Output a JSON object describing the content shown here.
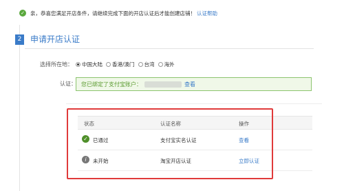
{
  "notice": {
    "icon": "check-circle-icon",
    "text": "亲，恭喜您满足开店条件，请继续完成下面的开店认证后才能创建店铺！",
    "link": "认证帮助"
  },
  "step": {
    "number": "2",
    "title": "申请开店认证"
  },
  "location": {
    "label": "选择所在地：",
    "options": [
      {
        "label": "中国大陆",
        "selected": true
      },
      {
        "label": "香港/澳门",
        "selected": false
      },
      {
        "label": "台湾",
        "selected": false
      },
      {
        "label": "海外",
        "selected": false
      }
    ]
  },
  "certification": {
    "label": "认证：",
    "text": "您已绑定了支付宝账户：",
    "link": "查看"
  },
  "table": {
    "headers": [
      "状态",
      "认证名称",
      "操作"
    ],
    "rows": [
      {
        "status": "已通过",
        "status_icon": "check-circle-icon",
        "name": "支付宝实名认证",
        "action": "查看"
      },
      {
        "status": "未开始",
        "status_icon": "info-circle-icon",
        "name": "淘宝开店认证",
        "action": "立即认证"
      }
    ]
  },
  "colors": {
    "accent": "#3a7bc8",
    "success": "#5aa83d",
    "highlight_border": "#e03a3a"
  }
}
